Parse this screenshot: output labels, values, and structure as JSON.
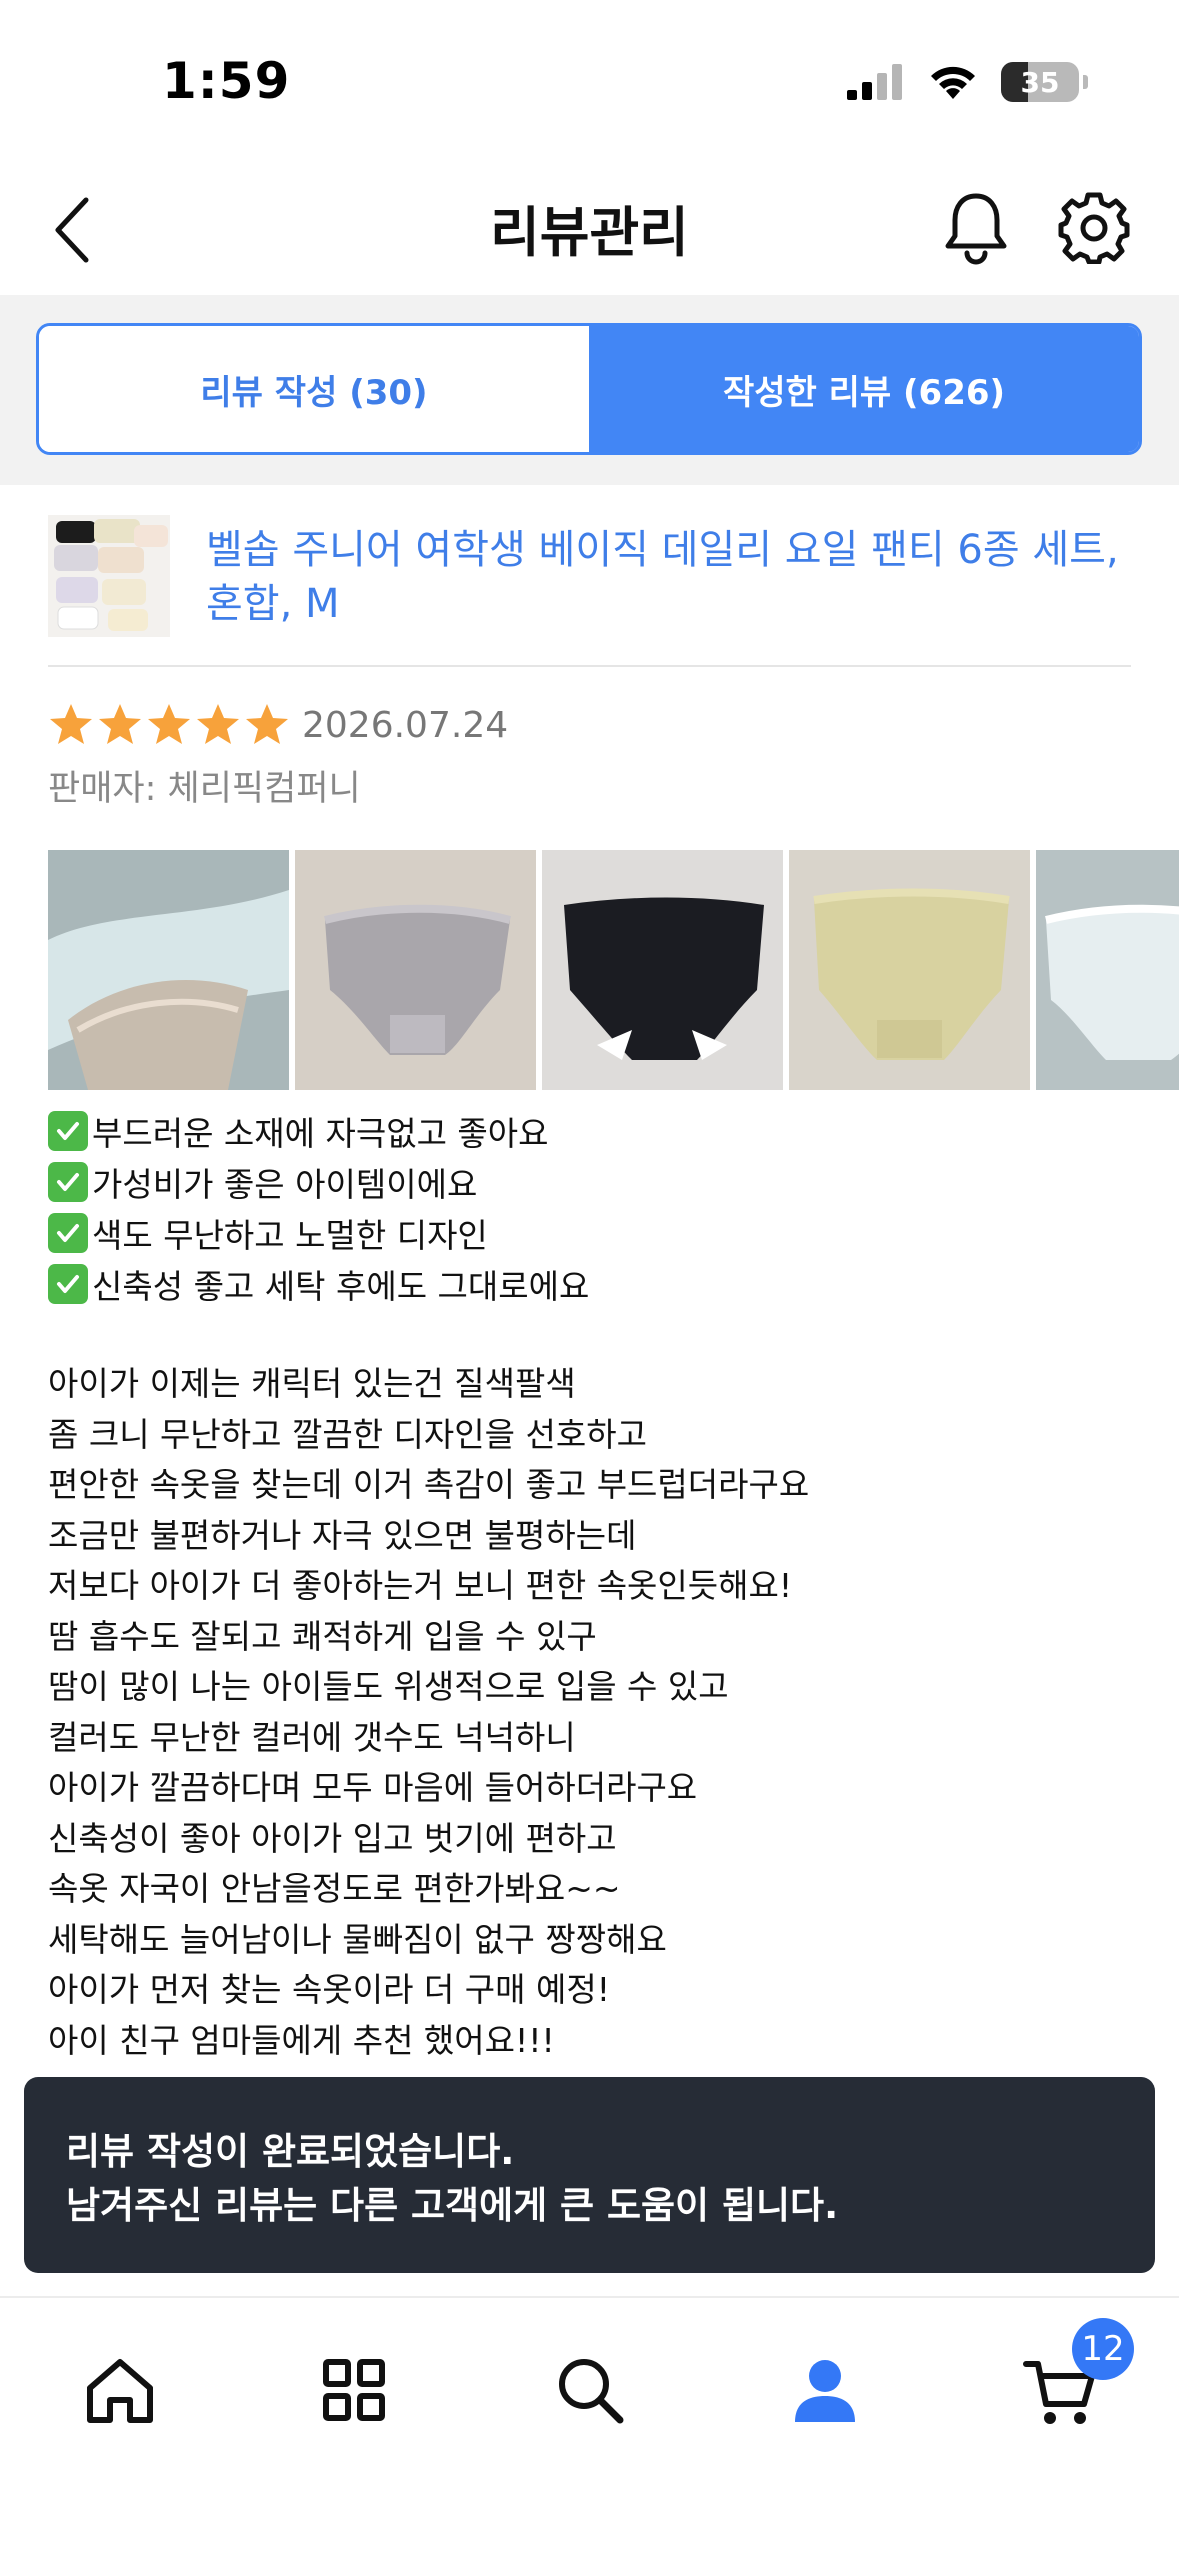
{
  "status_bar": {
    "time": "1:59",
    "battery_level": "35"
  },
  "header": {
    "title": "리뷰관리"
  },
  "tabs": [
    {
      "label": "리뷰 작성 (30)",
      "active": false
    },
    {
      "label": "작성한 리뷰 (626)",
      "active": true
    }
  ],
  "product": {
    "name": "벨솝 주니어 여학생 베이직 데일리 요일 팬티 6종 세트, 혼합, M"
  },
  "review": {
    "rating": 5,
    "max_rating": 5,
    "date": "2026.07.24",
    "seller": "판매자: 체리픽컴퍼니",
    "photo_count_visible": 5,
    "highlights": [
      "부드러운 소재에 자극없고 좋아요",
      "가성비가 좋은 아이템이에요",
      "색도 무난하고 노멀한 디자인",
      "신축성 좋고 세탁 후에도 그대로에요"
    ],
    "body_lines": [
      "아이가 이제는 캐릭터 있는건 질색팔색",
      "좀 크니 무난하고 깔끔한 디자인을 선호하고",
      "편안한 속옷을 찾는데 이거 촉감이 좋고 부드럽더라구요",
      "조금만 불편하거나 자극 있으면 불평하는데",
      "저보다 아이가 더 좋아하는거 보니 편한 속옷인듯해요!",
      "땀 흡수도 잘되고 쾌적하게 입을 수 있구",
      "땀이 많이 나는 아이들도 위생적으로 입을 수 있고",
      "컬러도 무난한 컬러에 갯수도 넉넉하니",
      "아이가 깔끔하다며 모두 마음에 들어하더라구요",
      "신축성이 좋아 아이가 입고 벗기에 편하고",
      "속옷 자국이 안남을정도로 편한가봐요~~",
      "세탁해도 늘어남이나 물빠짐이 없구 짱짱해요",
      "아이가 먼저 찾는 속옷이라 더 구매 예정!",
      "아이 친구 엄마들에게 추천 했어요!!!"
    ]
  },
  "toast": {
    "line1": "리뷰 작성이 완료되었습니다.",
    "line2": "남겨주신 리뷰는 다른 고객에게 큰 도움이 됩니다."
  },
  "bottom_nav": {
    "items": [
      "home-icon",
      "categories-icon",
      "search-icon",
      "my-page-icon",
      "cart-icon"
    ],
    "active": "my-page-icon",
    "cart_count": "12"
  },
  "colors": {
    "accent": "#4286f5",
    "link": "#3f7ee8",
    "star": "#f7a23b",
    "toast_bg": "#262c36",
    "check": "#4cb848"
  }
}
